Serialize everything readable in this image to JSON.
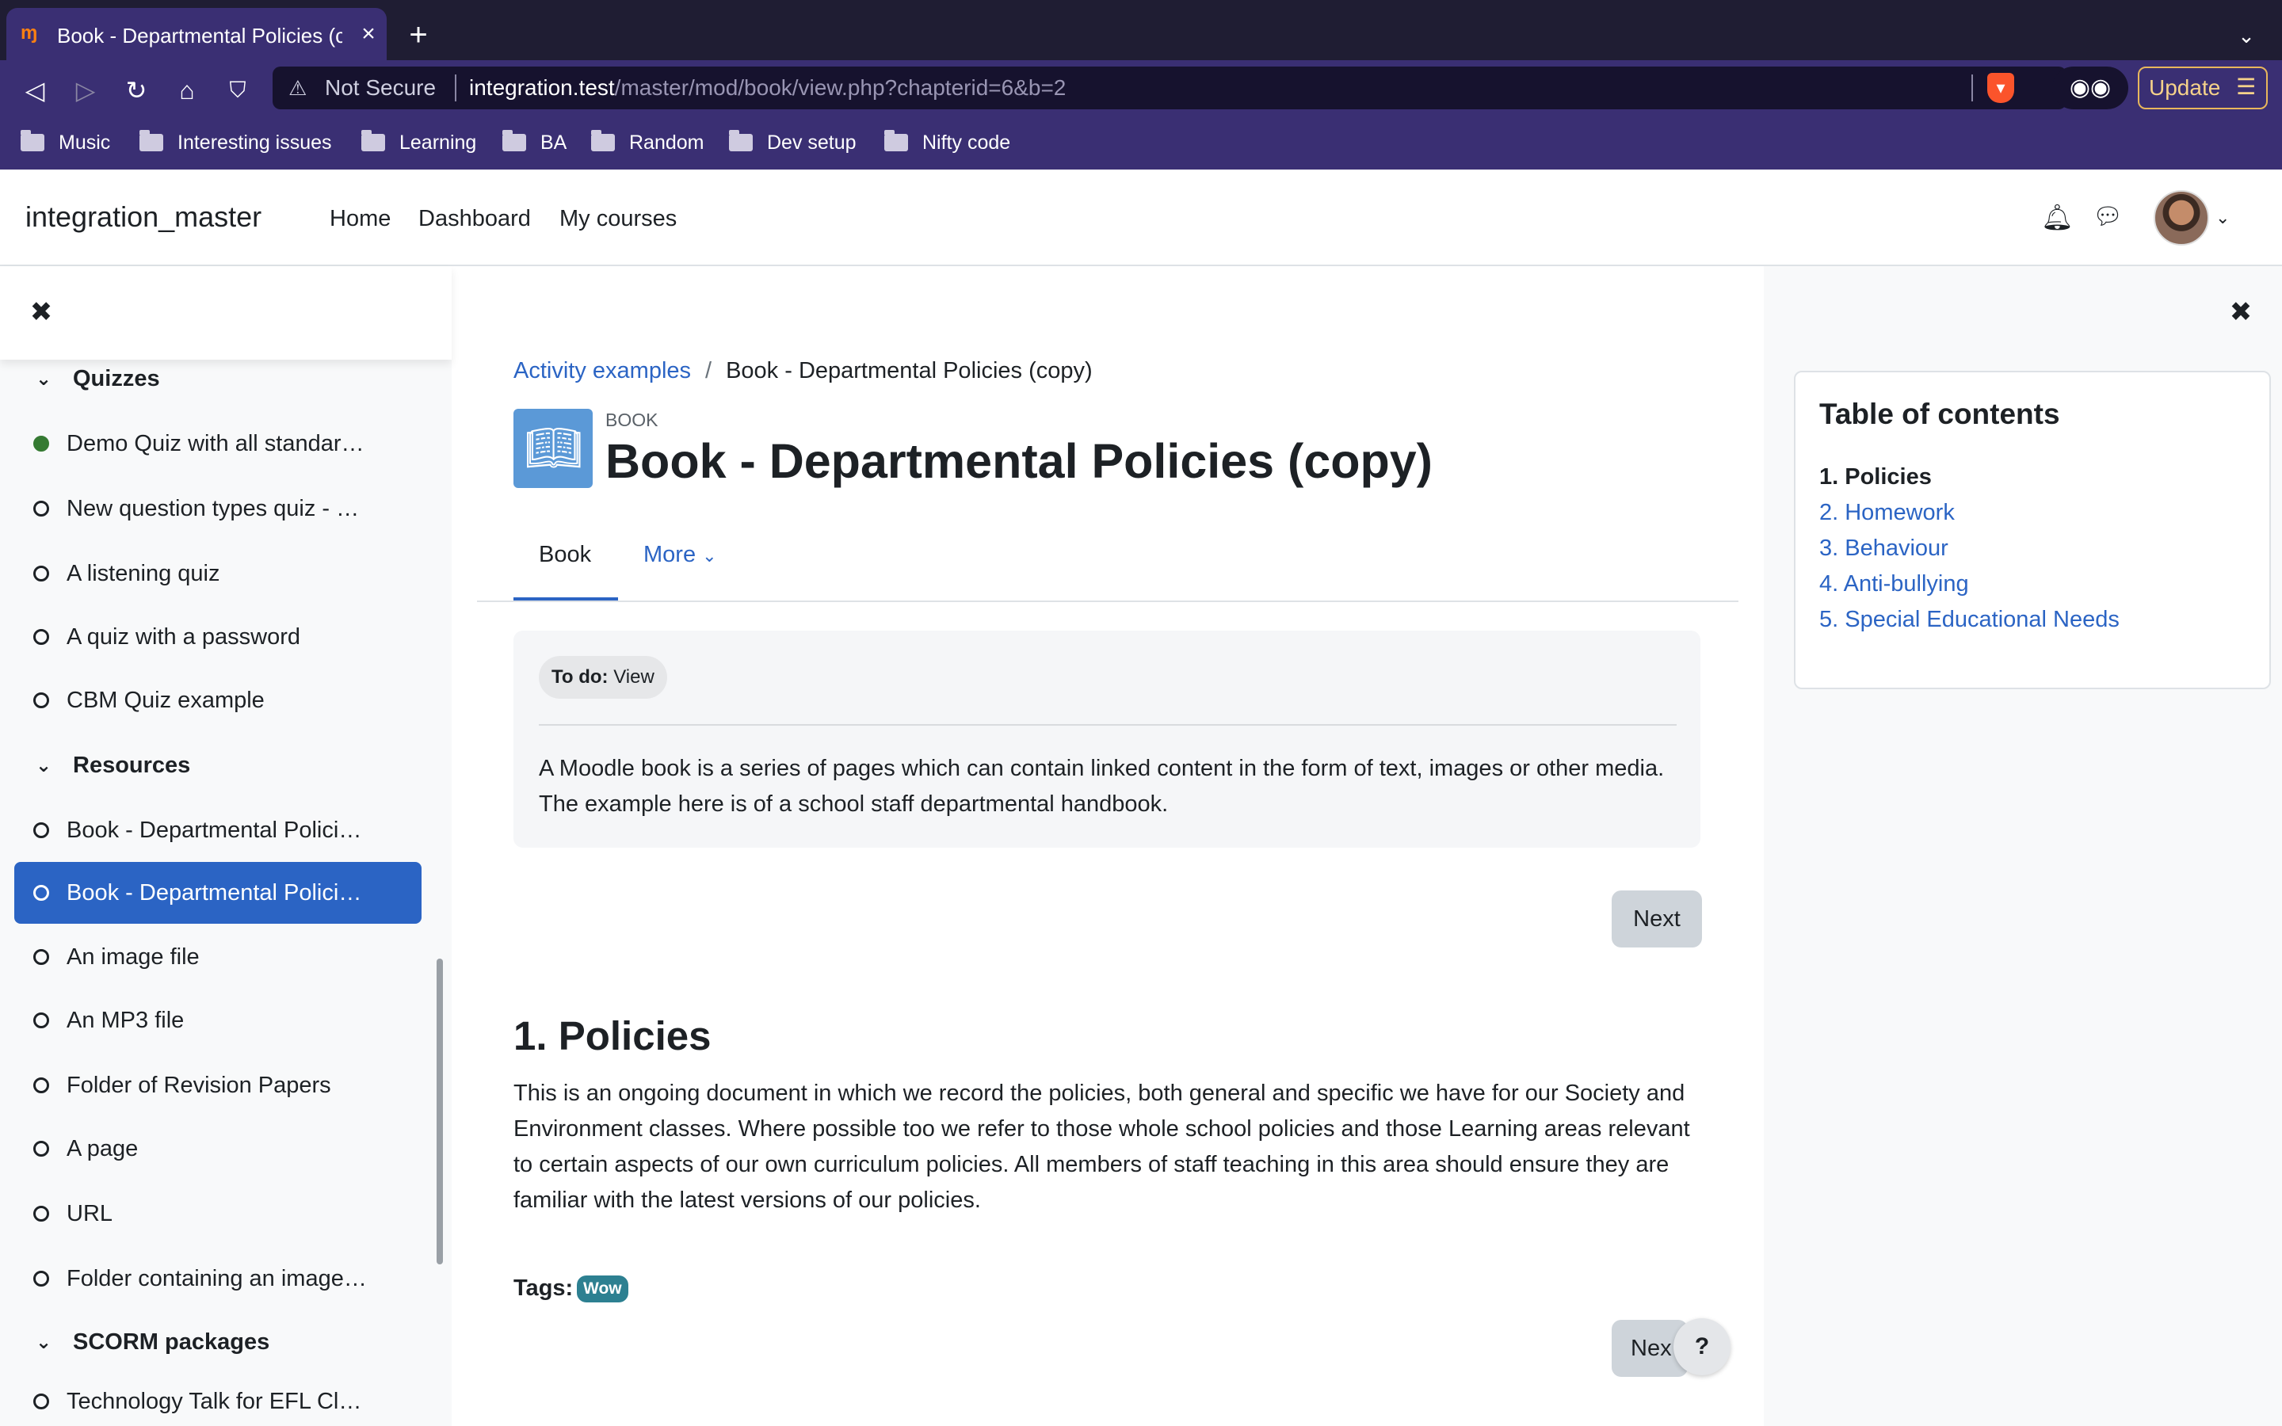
{
  "browser": {
    "tab_title": "Book - Departmental Policies (c",
    "tab_favicon": "moodle-favicon",
    "url_warning": "Not Secure",
    "url_host": "integration.test",
    "url_path": "/master/mod/book/view.php?chapterid=6&b=2",
    "update_label": "Update",
    "bookmarks": [
      "Music",
      "Interesting issues",
      "Learning",
      "BA",
      "Random",
      "Dev setup",
      "Nifty code"
    ]
  },
  "navbar": {
    "site_name": "integration_master",
    "links": [
      "Home",
      "Dashboard",
      "My courses"
    ]
  },
  "course_index": {
    "sections": [
      {
        "title": "Quizzes"
      },
      {
        "title": "Resources"
      },
      {
        "title": "SCORM packages"
      }
    ],
    "quizzes": [
      {
        "label": "Demo Quiz with all standar…",
        "completed": true
      },
      {
        "label": "New question types quiz - …",
        "completed": false
      },
      {
        "label": "A listening quiz",
        "completed": false
      },
      {
        "label": "A quiz with a password",
        "completed": false
      },
      {
        "label": "CBM Quiz example",
        "completed": false
      }
    ],
    "resources": [
      {
        "label": "Book - Departmental Polici…",
        "active": false
      },
      {
        "label": "Book - Departmental Polici…",
        "active": true
      },
      {
        "label": "An image file",
        "active": false
      },
      {
        "label": "An MP3 file",
        "active": false
      },
      {
        "label": "Folder of Revision Papers",
        "active": false
      },
      {
        "label": "A page",
        "active": false
      },
      {
        "label": "URL",
        "active": false
      },
      {
        "label": "Folder containing an image…",
        "active": false
      }
    ],
    "scorm": [
      {
        "label": "Technology Talk for EFL Cl…"
      }
    ]
  },
  "main": {
    "breadcrumb": {
      "parent": "Activity examples",
      "separator": "/",
      "current": "Book - Departmental Policies (copy)"
    },
    "activity_type": "BOOK",
    "title": "Book - Departmental Policies (copy)",
    "tabs": {
      "book": "Book",
      "more": "More"
    },
    "todo": {
      "label": "To do:",
      "value": "View"
    },
    "description": "A  Moodle book is a series of pages which can contain linked content  in the form of text, images or other media. The example here is of a school staff departmental handbook.",
    "next_label": "Next",
    "next_label_bottom": "Nex",
    "chapter_title": "1. Policies",
    "chapter_body": "This is an ongoing document in which we record the policies, both general and specific we have for our Society and Environment classes. Where possible too we refer to those whole school policies and those Learning areas relevant to certain aspects of our own curriculum policies. All members of staff teaching in this area should ensure they are familiar with the latest versions of our policies.",
    "tags_label": "Tags:",
    "tag": "Wow",
    "help": "?"
  },
  "toc": {
    "title": "Table of contents",
    "items": [
      "1. Policies",
      "2. Homework",
      "3. Behaviour",
      "4. Anti-bullying",
      "5. Special Educational Needs"
    ],
    "current_index": 0
  },
  "colors": {
    "accent": "#2b64c4",
    "browser_bg": "#3a2f73",
    "tag": "#2d8091",
    "complete": "#357a32"
  }
}
